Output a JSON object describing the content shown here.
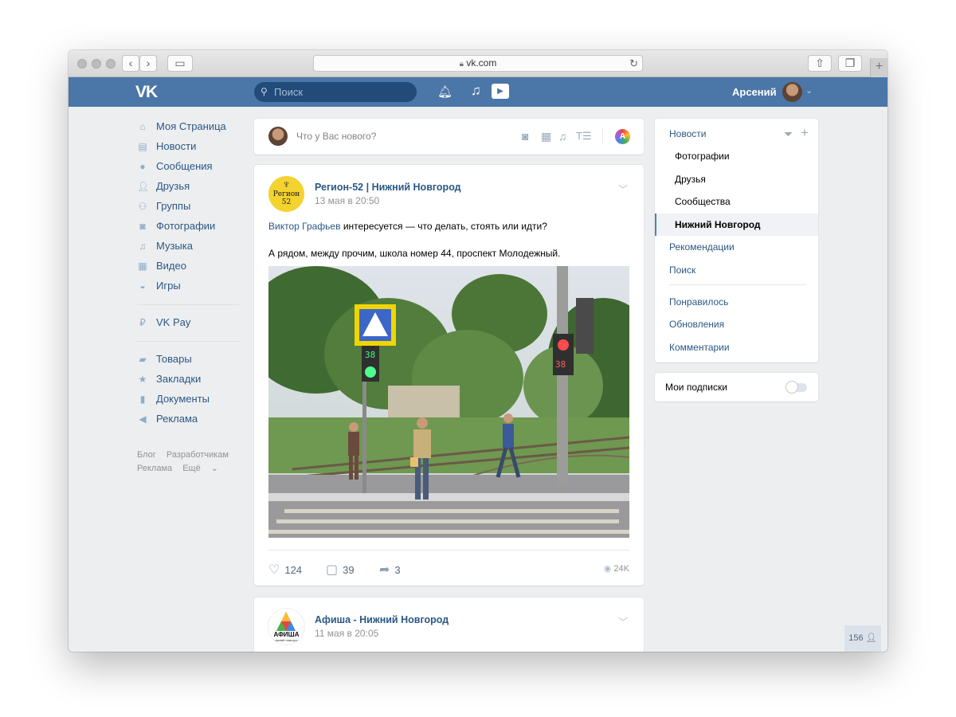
{
  "browser": {
    "url": "vk.com"
  },
  "header": {
    "logo": "VK",
    "search_placeholder": "Поиск",
    "user_name": "Арсений"
  },
  "left_menu": {
    "items": [
      {
        "label": "Моя Страница",
        "icon": "home-icon"
      },
      {
        "label": "Новости",
        "icon": "news-icon"
      },
      {
        "label": "Сообщения",
        "icon": "messages-icon"
      },
      {
        "label": "Друзья",
        "icon": "friends-icon"
      },
      {
        "label": "Группы",
        "icon": "groups-icon"
      },
      {
        "label": "Фотографии",
        "icon": "camera-icon"
      },
      {
        "label": "Музыка",
        "icon": "music-icon"
      },
      {
        "label": "Видео",
        "icon": "video-icon"
      },
      {
        "label": "Игры",
        "icon": "gamepad-icon"
      },
      {
        "label": "VK Pay",
        "icon": "vkpay-icon"
      },
      {
        "label": "Товары",
        "icon": "bag-icon"
      },
      {
        "label": "Закладки",
        "icon": "star-icon"
      },
      {
        "label": "Документы",
        "icon": "document-icon"
      },
      {
        "label": "Реклама",
        "icon": "megaphone-icon"
      }
    ],
    "footer": [
      "Блог",
      "Разработчикам",
      "Реклама",
      "Ещё"
    ]
  },
  "composer": {
    "placeholder": "Что у Вас нового?",
    "ai_badge": "A"
  },
  "posts": [
    {
      "group_name": "Регион-52 | Нижний Новгород",
      "avatar_text_top": "Регион",
      "avatar_text_bottom": "52",
      "date": "13 мая в 20:50",
      "author_link": "Виктор Графьев",
      "line1_rest": " интересуется — что делать, стоять или идти?",
      "line2": "А рядом, между прочим, школа номер 44, проспект Молодежный.",
      "likes": "124",
      "comments": "39",
      "shares": "3",
      "views": "24K",
      "photo_timer_left": "38",
      "photo_timer_right": "38"
    },
    {
      "group_name": "Афиша - Нижний Новгород",
      "avatar_text": "АФИША",
      "avatar_subtext": "нижний новгород",
      "date": "11 мая в 20:05"
    }
  ],
  "right_menu": {
    "items": [
      {
        "label": "Новости",
        "kind": "link"
      },
      {
        "label": "Фотографии",
        "kind": "sub"
      },
      {
        "label": "Друзья",
        "kind": "sub"
      },
      {
        "label": "Сообщества",
        "kind": "sub"
      },
      {
        "label": "Нижний Новгород",
        "kind": "active"
      },
      {
        "label": "Рекомендации",
        "kind": "link"
      },
      {
        "label": "Поиск",
        "kind": "link"
      },
      {
        "label": "Понравилось",
        "kind": "link"
      },
      {
        "label": "Обновления",
        "kind": "link"
      },
      {
        "label": "Комментарии",
        "kind": "link"
      }
    ],
    "subscriptions_label": "Мои подписки",
    "subscriptions_on": false
  },
  "online_count": "156",
  "colors": {
    "vk_blue": "#4a76a8",
    "link": "#2a5885",
    "background": "#edeef0"
  }
}
